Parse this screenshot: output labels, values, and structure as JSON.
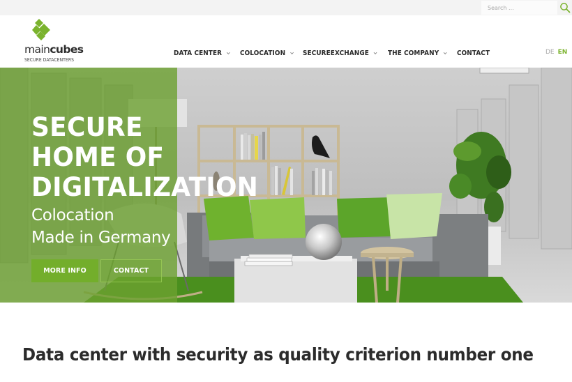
{
  "topbar": {
    "search_placeholder": "Search ...",
    "search_icon": "search-icon"
  },
  "brand": {
    "name_light": "main",
    "name_bold": "cubes",
    "tagline": "SECURE DATACENTERS",
    "logo_icon": "cubes-logo-icon",
    "color": "#7bb32e"
  },
  "nav": {
    "items": [
      {
        "label": "DATA CENTER",
        "has_dropdown": true
      },
      {
        "label": "COLOCATION",
        "has_dropdown": true
      },
      {
        "label": "SECUREEXCHANGE",
        "has_dropdown": true
      },
      {
        "label": "THE COMPANY",
        "has_dropdown": true
      },
      {
        "label": "CONTACT",
        "has_dropdown": false
      }
    ],
    "languages": [
      {
        "code": "DE",
        "active": false
      },
      {
        "code": "EN",
        "active": true
      }
    ]
  },
  "hero": {
    "title_lines": [
      "SECURE",
      "HOME OF",
      "DIGITALIZATION"
    ],
    "subtitle_lines": [
      "Colocation",
      "Made in Germany"
    ],
    "primary_button": "MORE INFO",
    "secondary_button": "CONTACT",
    "overlay_color": "#6ca030",
    "image_description": "Lounge with grey sofa, green cushions, chrome sphere, white coffee table, bookshelf, plant and server racks"
  },
  "section": {
    "title": "Data center with security as quality criterion number one"
  }
}
